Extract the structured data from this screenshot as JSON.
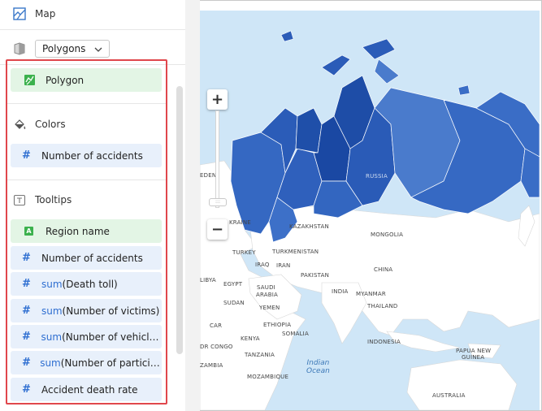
{
  "panel": {
    "chart_type_label": "Map",
    "layer_select": {
      "value": "Polygons",
      "icon": "chevron-down-icon"
    },
    "geo_section": {
      "items": [
        {
          "label": "Polygon",
          "kind": "geo"
        }
      ]
    },
    "colors_section": {
      "title": "Colors",
      "items": [
        {
          "label": "Number of accidents",
          "kind": "measure"
        }
      ]
    },
    "tooltips_section": {
      "title": "Tooltips",
      "items": [
        {
          "prefix": "",
          "label": "Region name",
          "kind": "dimension"
        },
        {
          "prefix": "",
          "label": "Number of accidents",
          "kind": "measure"
        },
        {
          "prefix": "sum",
          "label": "(Death toll)",
          "kind": "measure"
        },
        {
          "prefix": "sum",
          "label": "(Number of victims)",
          "kind": "measure"
        },
        {
          "prefix": "sum",
          "label": "(Number of vehicles)",
          "kind": "measure"
        },
        {
          "prefix": "sum",
          "label": "(Number of participa...",
          "kind": "measure"
        },
        {
          "prefix": "",
          "label": "Accident death rate",
          "kind": "measure"
        }
      ]
    },
    "colors": {
      "measure_chip": "#e8f0fb",
      "dimension_chip": "#e3f5e5",
      "highlight_border": "#e0474c"
    }
  },
  "map": {
    "labels": {
      "russia": "RUSSIA",
      "kazakhstan": "KAZAKHSTAN",
      "mongolia": "MONGOLIA",
      "china": "CHINA",
      "turkey": "TURKEY",
      "turkmenistan": "TURKMENISTAN",
      "iraq": "IRAQ",
      "iran": "IRAN",
      "pakistan": "PAKISTAN",
      "india": "INDIA",
      "myanmar": "MYANMAR",
      "thailand": "THAILAND",
      "indonesia": "INDONESIA",
      "papua": "PAPUA NEW",
      "guinea": "GUINEA",
      "australia": "AUSTRALIA",
      "egypt": "EGYPT",
      "saudi1": "SAUDI",
      "saudi2": "ARABIA",
      "yemen": "YEMEN",
      "sudan": "SUDAN",
      "ethiopia": "ETHIOPIA",
      "kenya": "KENYA",
      "tanzania": "TANZANIA",
      "mozambique": "MOZAMBIQUE",
      "somalia": "SOMALIA",
      "car": "CAR",
      "libya": "LIBYA",
      "drcongo": "DR CONGO",
      "zambia": "ZAMBIA",
      "sweden": "EDEN",
      "ukraine": "KRAINE",
      "indian_ocean_1": "Indian",
      "indian_ocean_2": "Ocean"
    },
    "zoom": {
      "plus": "+",
      "minus": "−",
      "knob": ":::"
    },
    "colors": {
      "water": "#cfe6f7",
      "land": "#ffffff",
      "region_dark": "#1a4fae",
      "region_mid": "#2e62bf",
      "region_light": "#4a7bcc"
    }
  }
}
